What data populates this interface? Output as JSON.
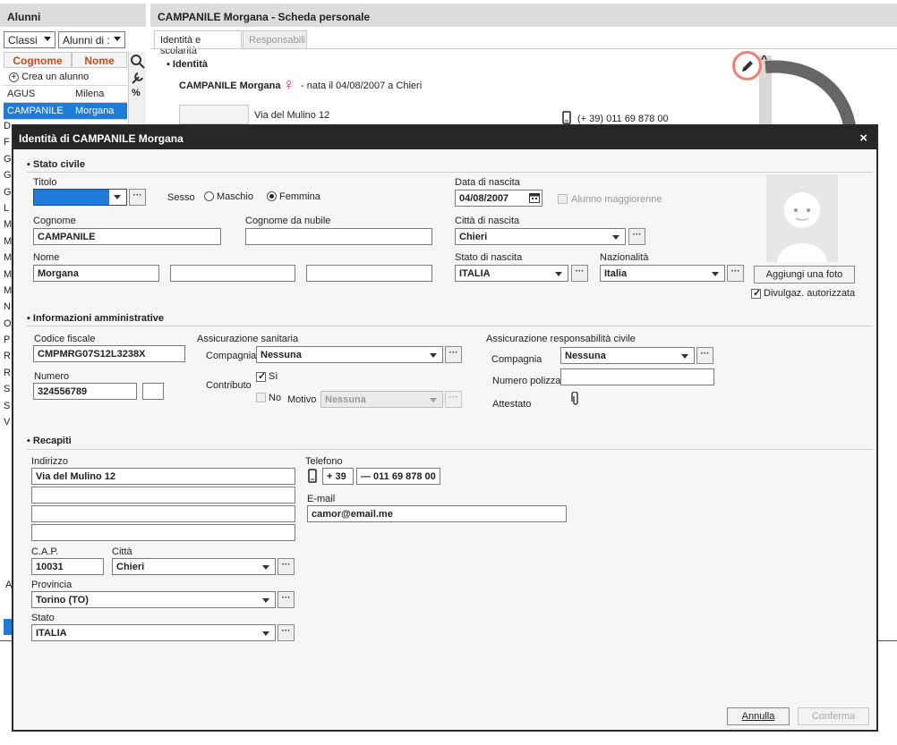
{
  "left_panel": {
    "title": "Alunni",
    "classi_label": "Classi",
    "alunni_label": "Alunni di :",
    "col_cognome": "Cognome",
    "col_nome": "Nome",
    "create_label": "Crea un alunno",
    "rows": [
      {
        "cognome": "AGUS",
        "nome": "Milena"
      },
      {
        "cognome": "CAMPANILE",
        "nome": "Morgana"
      }
    ],
    "letters": [
      "D",
      "F",
      "G",
      "G",
      "G",
      "L",
      "M",
      "M",
      "M",
      "M",
      "M",
      "N",
      "O",
      "P",
      "R",
      "R",
      "S",
      "S",
      "V"
    ],
    "bottom_letter": "A"
  },
  "right_panel": {
    "title": "CAMPANILE Morgana - Scheda personale",
    "tabs": [
      "Identità e scolarità",
      "Responsabili"
    ],
    "section": "Identità",
    "student_name": "CAMPANILE Morgana",
    "gender_symbol": "♀",
    "birth_info": "- nata il 04/08/2007 a Chieri",
    "address": "Via del Mulino 12",
    "phone": "(+ 39) 011 69 878 00",
    "collapse_symbol": "^"
  },
  "dialog": {
    "title": "Identità di CAMPANILE Morgana",
    "close": "×",
    "stato_civile": {
      "section": "Stato civile",
      "titolo_label": "Titolo",
      "titolo_value": "",
      "sesso_label": "Sesso",
      "maschio": "Maschio",
      "femmina": "Femmina",
      "data_label": "Data di nascita",
      "data_value": "04/08/2007",
      "maggiorenne": "Alunno maggiorenne",
      "cognome_label": "Cognome",
      "cognome_value": "CAMPANILE",
      "nubile_label": "Cognome da nubile",
      "nubile_value": "",
      "citta_label": "Città di nascita",
      "citta_value": "Chieri",
      "nome_label": "Nome",
      "nome_value": "Morgana",
      "nome2_value": "",
      "nome3_value": "",
      "stato_label": "Stato di nascita",
      "stato_value": "ITALIA",
      "naz_label": "Nazionalità",
      "naz_value": "Italia",
      "foto_button": "Aggiungi una foto",
      "divulgaz": "Divulgaz. autorizzata"
    },
    "info_amm": {
      "section": "Informazioni amministrative",
      "cf_label": "Codice fiscale",
      "cf_value": "CMPMRG07S12L3238X",
      "numero_label": "Numero",
      "numero_value": "324556789",
      "numero_extra": "",
      "ass_san_label": "Assicurazione sanitaria",
      "compagnia_label": "Compagnia",
      "compagnia_value": "Nessuna",
      "contributo_label": "Contributo",
      "si": "Sì",
      "no": "No",
      "motivo_label": "Motivo",
      "motivo_value": "Nessuna",
      "ass_rc_label": "Assicurazione responsabilità civile",
      "rc_compagnia_label": "Compagnia",
      "rc_compagnia_value": "Nessuna",
      "polizza_label": "Numero polizza",
      "polizza_value": "",
      "attestato_label": "Attestato"
    },
    "recapiti": {
      "section": "Recapiti",
      "indirizzo_label": "Indirizzo",
      "indirizzo1": "Via del Mulino 12",
      "indirizzo2": "",
      "indirizzo3": "",
      "indirizzo4": "",
      "telefono_label": "Telefono",
      "prefix": "+ 39",
      "numero": "— 011 69 878 00",
      "email_label": "E-mail",
      "email_value": "camor@email.me",
      "cap_label": "C.A.P.",
      "cap_value": "10031",
      "citta_label": "Città",
      "citta_value": "Chieri",
      "provincia_label": "Provincia",
      "provincia_value": "Torino (TO)",
      "stato_label": "Stato",
      "stato_value": "ITALIA"
    },
    "buttons": {
      "annulla": "Annulla",
      "conferma": "Conferma"
    },
    "dots": "···"
  },
  "colors": {
    "selected_row": "#1e7bd7",
    "accent": "#c0501e",
    "highlight_ring": "#f08070",
    "dialog_title_bg": "#262626"
  },
  "icons": [
    "magnifier-icon",
    "wrench-icon",
    "percent-icon",
    "pencil-icon",
    "arrow-icon",
    "calendar-icon",
    "mobile-phone-icon",
    "paperclip-icon",
    "avatar-placeholder-icon",
    "plus-circle-icon"
  ]
}
